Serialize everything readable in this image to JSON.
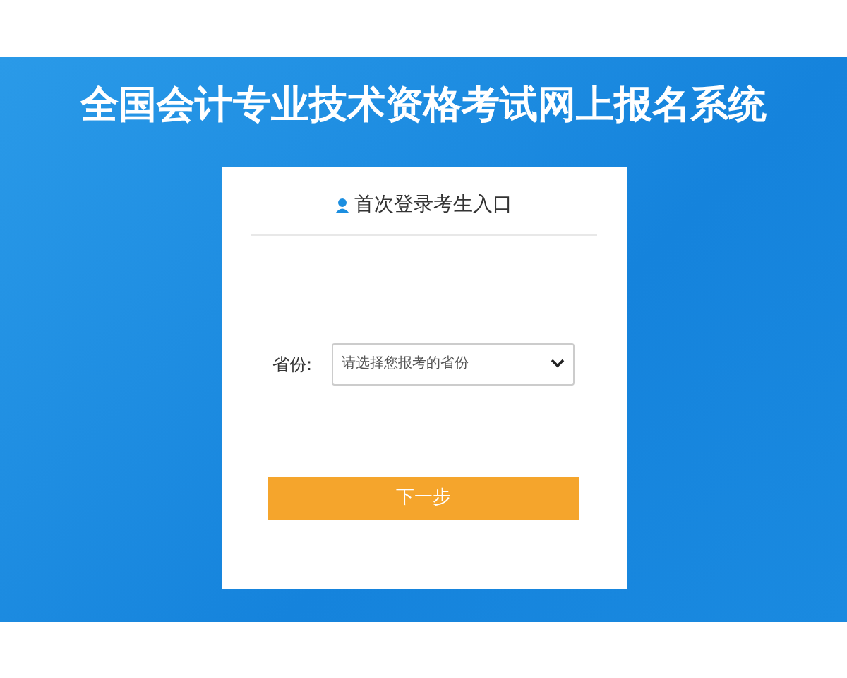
{
  "title": "全国会计专业技术资格考试网上报名系统",
  "login": {
    "heading": "首次登录考生入口",
    "field_label": "省份:",
    "select": {
      "placeholder": "请选择您报考的省份"
    },
    "button": "下一步"
  }
}
